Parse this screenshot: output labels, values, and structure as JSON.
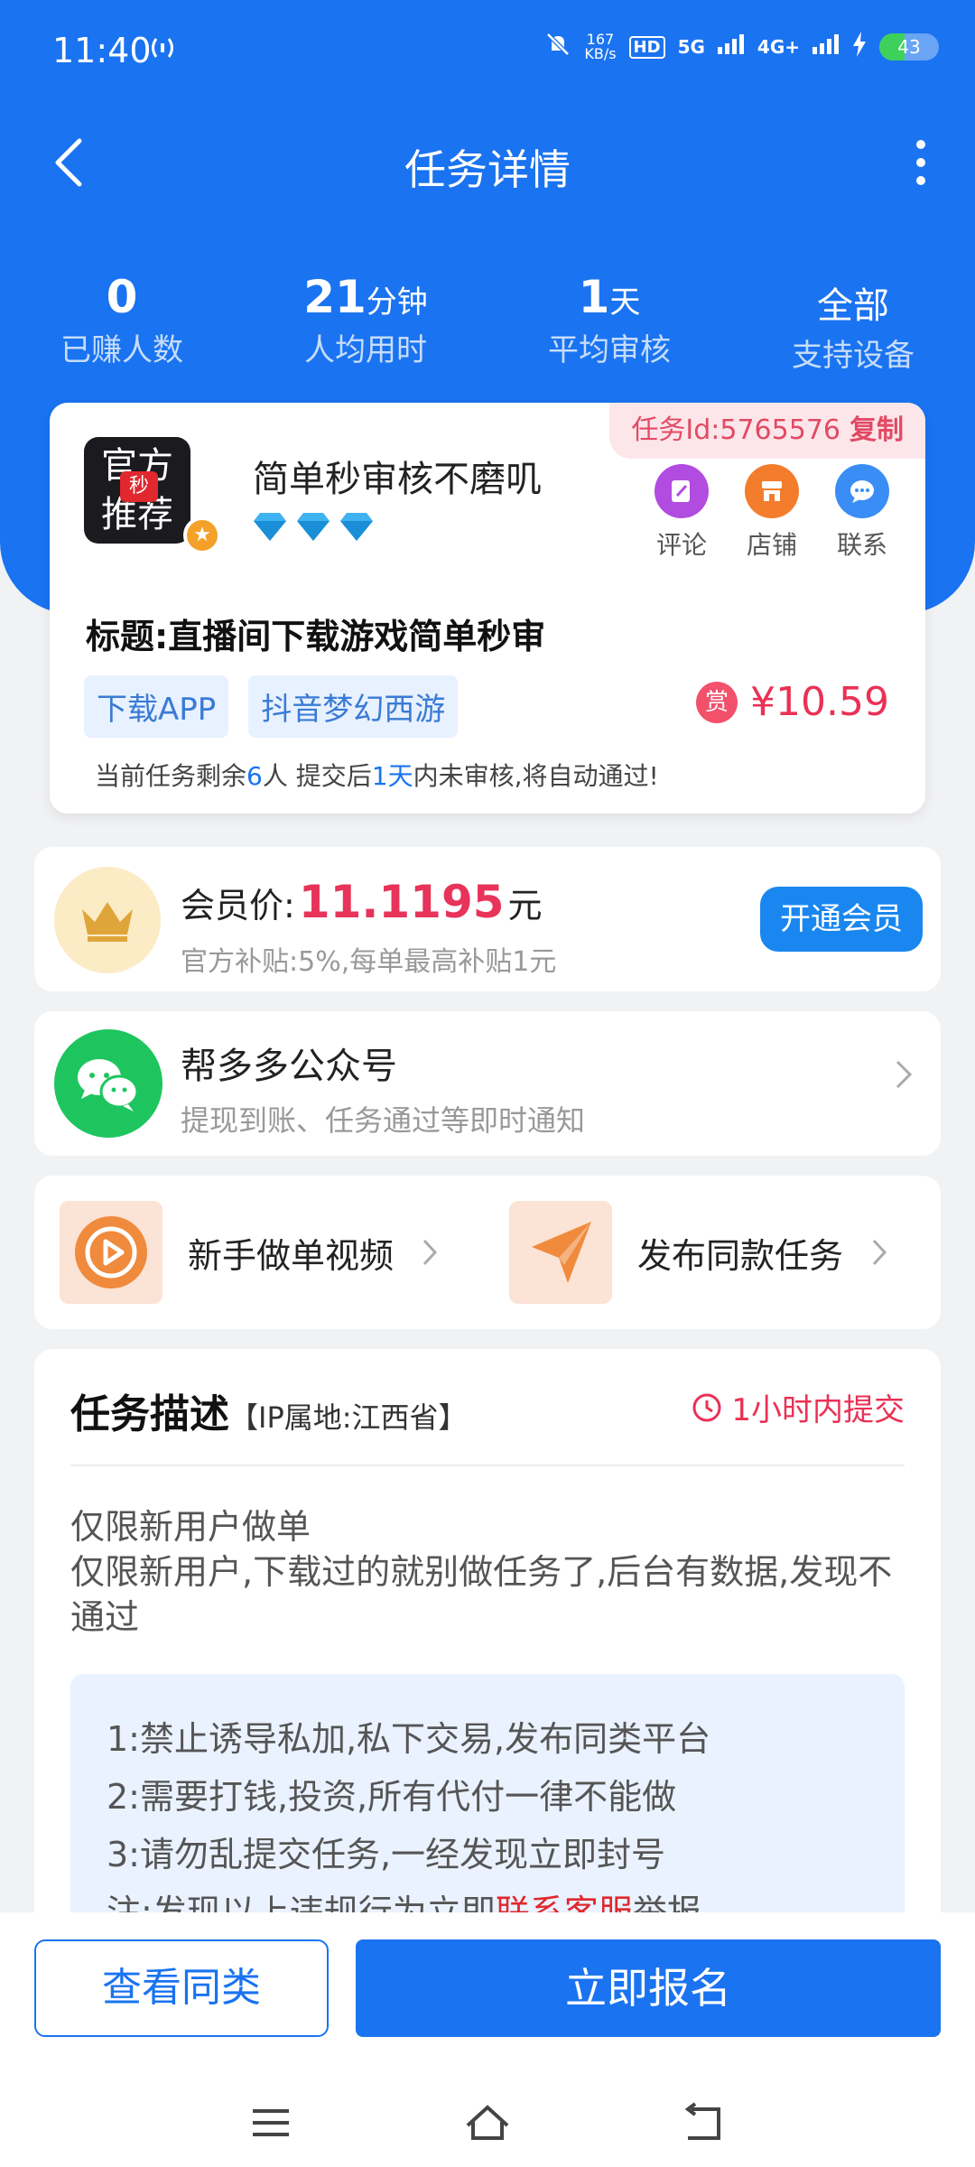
{
  "status_bar": {
    "time": "11:40",
    "net_speed_value": "167",
    "net_speed_unit": "KB/s",
    "net1": "5G",
    "net2": "4G+",
    "battery": "43",
    "battery_level": 0.43
  },
  "header": {
    "title": "任务详情"
  },
  "stats": [
    {
      "value": "0",
      "unit": "",
      "label": "已赚人数"
    },
    {
      "value": "21",
      "unit": "分钟",
      "label": "人均用时"
    },
    {
      "value": "1",
      "unit": "天",
      "label": "平均审核"
    },
    {
      "value": "全部",
      "unit": "",
      "label": "支持设备"
    }
  ],
  "task": {
    "id_label": "任务Id:5765576",
    "copy_label": "复制",
    "logo_line1": "官方",
    "logo_badge": "秒",
    "logo_line2": "推荐",
    "name": "简单秒审核不磨叽",
    "diamonds": 3,
    "actions": [
      {
        "label": "评论",
        "icon": "comment-icon",
        "color": "#b24be0"
      },
      {
        "label": "店铺",
        "icon": "store-icon",
        "color": "#f37d2d"
      },
      {
        "label": "联系",
        "icon": "chat-icon",
        "color": "#3a8df5"
      }
    ],
    "title": "标题:直播间下载游戏简单秒审",
    "tags": [
      "下载APP",
      "抖音梦幻西游"
    ],
    "reward_badge": "赏",
    "price": "¥10.59",
    "note_prefix": "当前任务剩余",
    "note_remaining": "6",
    "note_mid": "人  提交后",
    "note_days": "1天",
    "note_suffix": "内未审核,将自动通过!"
  },
  "vip": {
    "label": "会员价:",
    "price": "11.1195",
    "unit": "元",
    "sub": "官方补贴:5%,每单最高补贴1元",
    "button": "开通会员"
  },
  "wechat": {
    "title": "帮多多公众号",
    "sub": "提现到账、任务通过等即时通知"
  },
  "quick": {
    "left": "新手做单视频",
    "right": "发布同款任务"
  },
  "description": {
    "heading": "任务描述",
    "ip": "【IP属地:江西省】",
    "time_limit": "1小时内提交",
    "body_line1": "仅限新用户做单",
    "body_line2": "仅限新用户,下载过的就别做任务了,后台有数据,发现不通过",
    "rule1": "1:禁止诱导私加,私下交易,发布同类平台",
    "rule2": "2:需要打钱,投资,所有代付一律不能做",
    "rule3": "3:请勿乱提交任务,一经发现立即封号",
    "rule4_prefix": "注:发现以上违规行为立即",
    "rule4_link": "联系客服",
    "rule4_suffix": "举报"
  },
  "bottom": {
    "similar": "查看同类",
    "signup": "立即报名"
  }
}
